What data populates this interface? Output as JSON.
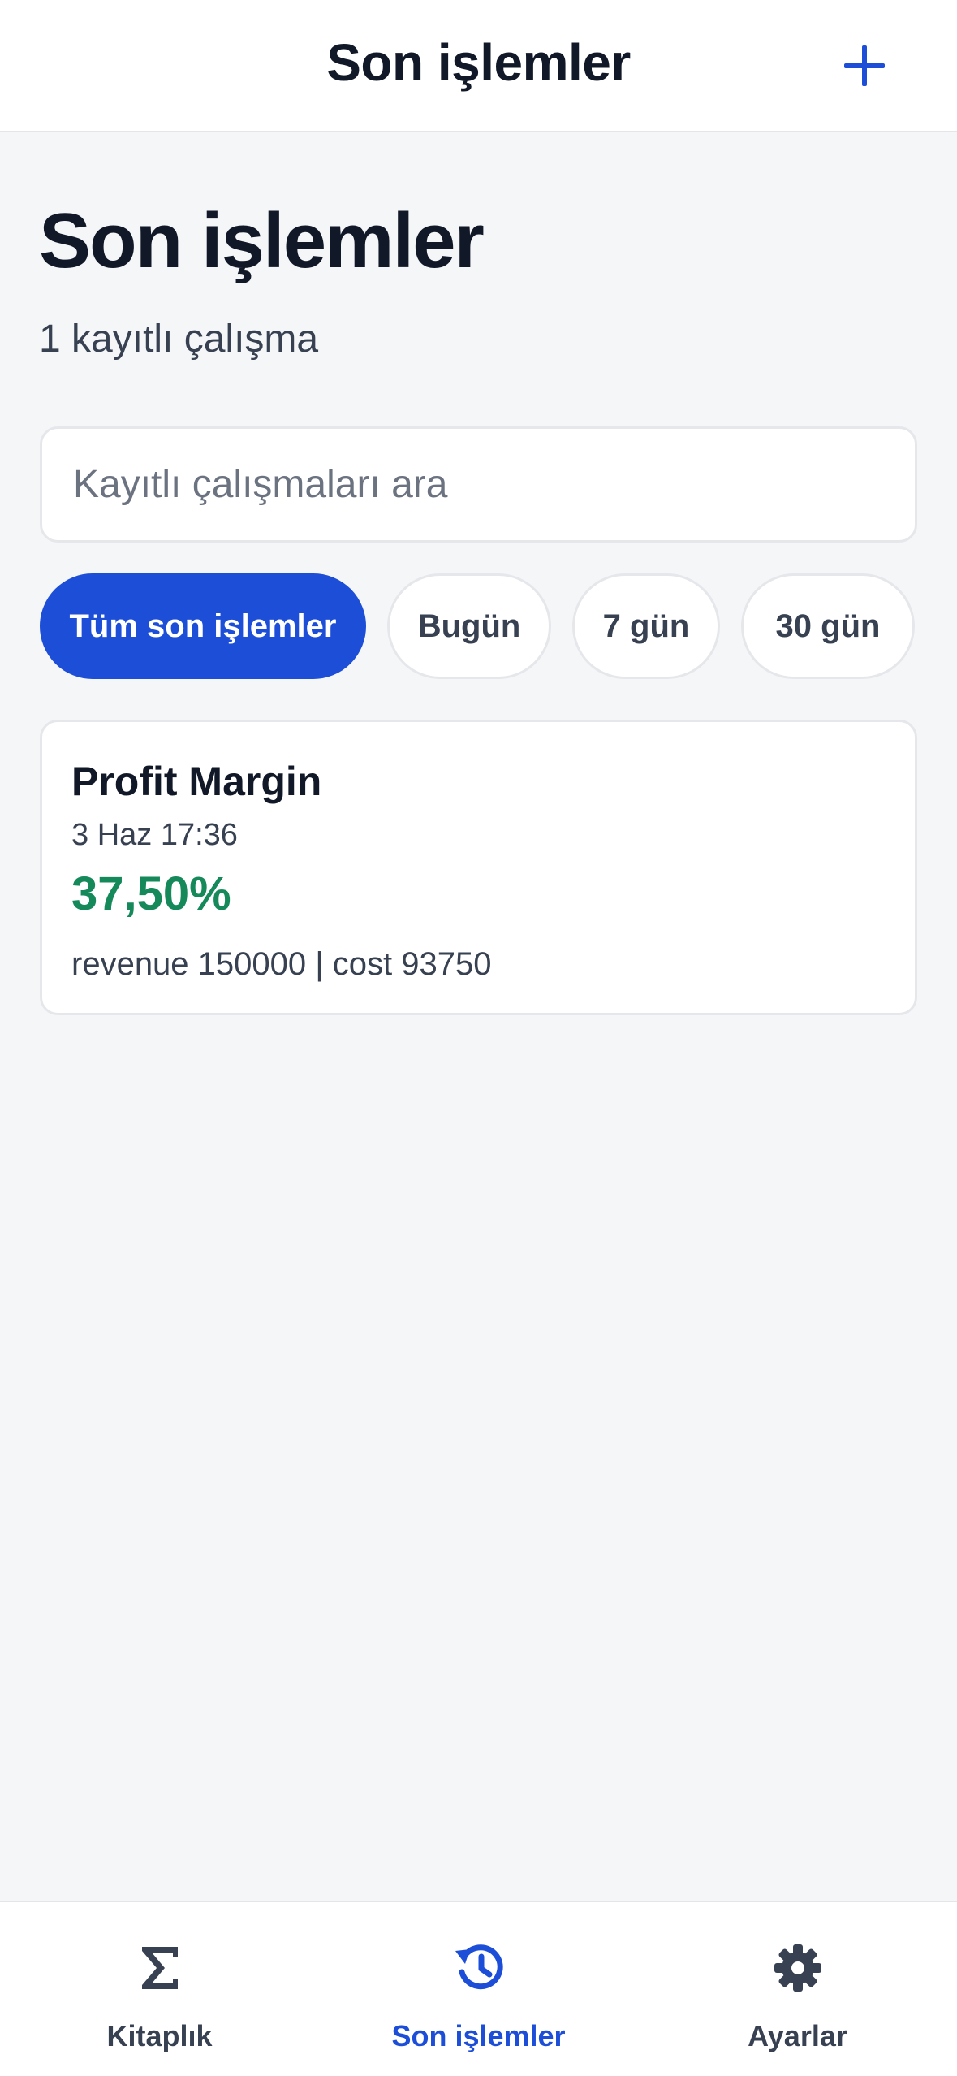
{
  "header": {
    "title": "Son işlemler",
    "add_icon": "plus-icon"
  },
  "main": {
    "title": "Son işlemler",
    "subtitle": "1 kayıtlı çalışma",
    "search": {
      "placeholder": "Kayıtlı çalışmaları ara",
      "value": ""
    },
    "filters": [
      {
        "label": "Tüm son işlemler",
        "active": true
      },
      {
        "label": "Bugün",
        "active": false
      },
      {
        "label": "7 gün",
        "active": false
      },
      {
        "label": "30 gün",
        "active": false
      }
    ],
    "records": [
      {
        "title": "Profit Margin",
        "date": "3 Haz 17:36",
        "result": "37,50%",
        "inputs": "revenue 150000 | cost 93750"
      }
    ]
  },
  "tab_bar": {
    "items": [
      {
        "label": "Kitaplık",
        "icon": "sigma-icon",
        "active": false
      },
      {
        "label": "Son işlemler",
        "icon": "history-icon",
        "active": true
      },
      {
        "label": "Ayarlar",
        "icon": "gear-icon",
        "active": false
      }
    ]
  },
  "colors": {
    "accent": "#1d4ed8",
    "result_green": "#15895a",
    "background": "#f5f6f8",
    "text_primary": "#111827"
  }
}
